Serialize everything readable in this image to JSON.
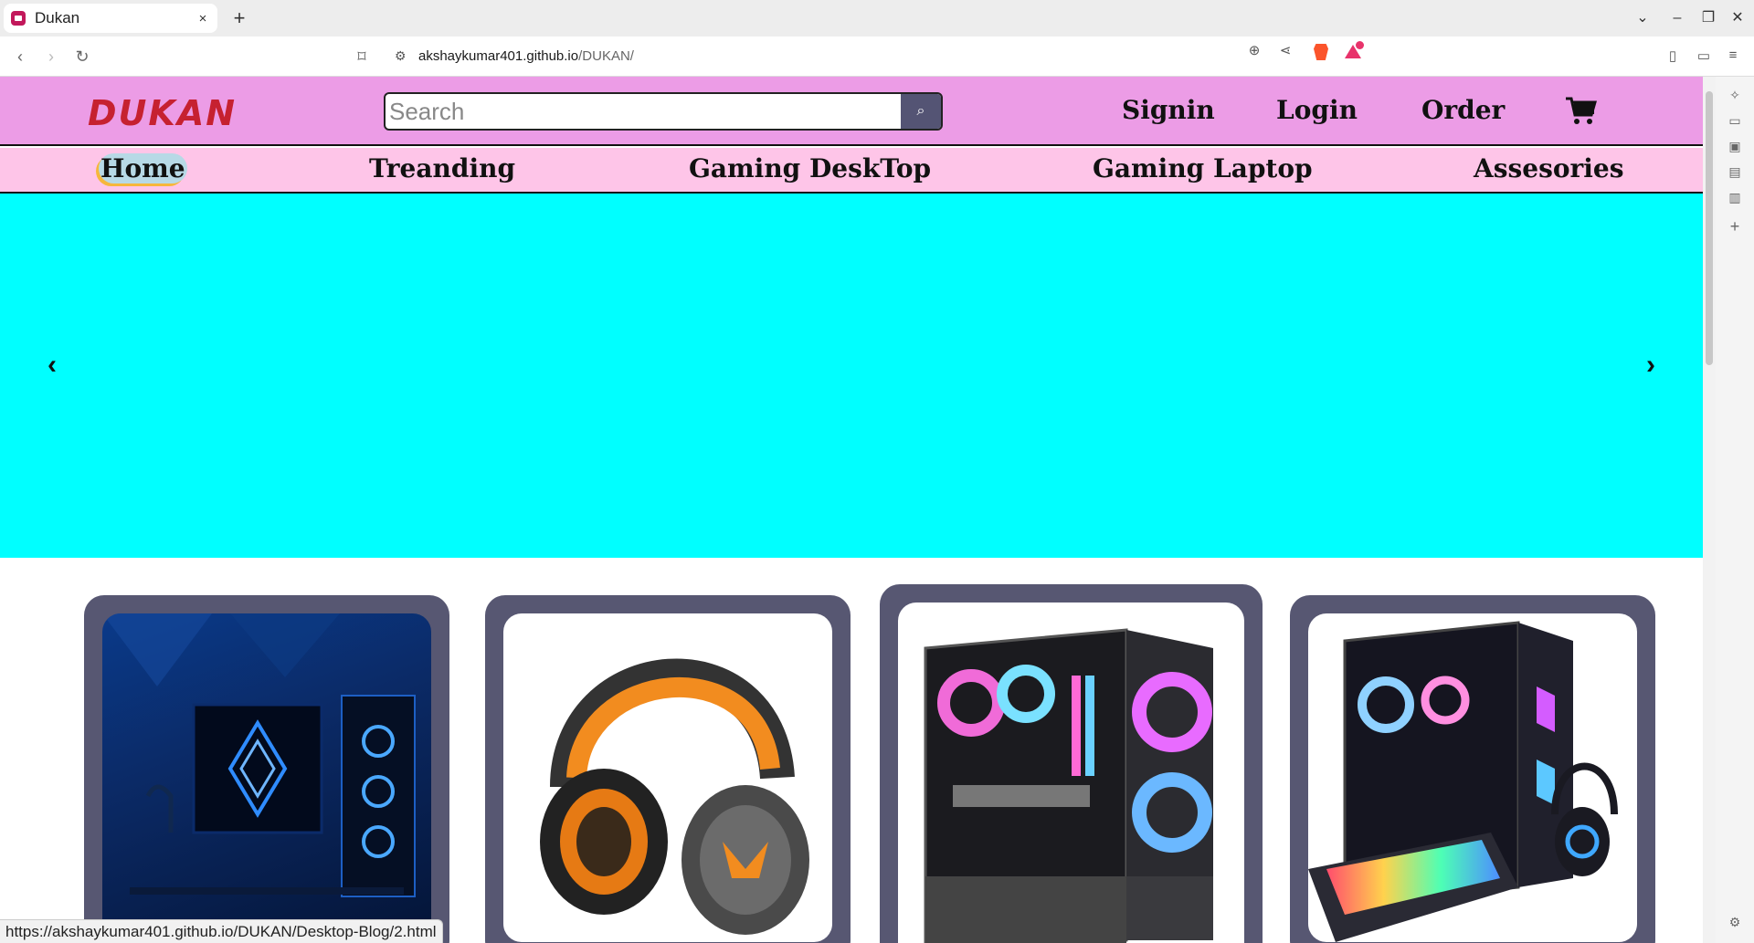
{
  "browser": {
    "tab_title": "Dukan",
    "tab_close": "×",
    "new_tab": "+",
    "url_host": "akshaykumar401.github.io",
    "url_path": "/DUKAN/",
    "status_url": "https://akshaykumar401.github.io/DUKAN/Desktop-Blog/2.html"
  },
  "header": {
    "logo": "DUKAN",
    "search_placeholder": "Search",
    "links": [
      "Signin",
      "Login",
      "Order"
    ]
  },
  "nav": {
    "items": [
      "Home",
      "Treanding",
      "Gaming DeskTop",
      "Gaming Laptop",
      "Assesories"
    ],
    "active": "Home"
  },
  "hero": {
    "background": "#00ffff",
    "prev": "‹",
    "next": "›"
  },
  "products": [
    {
      "image": "gaming-desk-setup-image"
    },
    {
      "image": "gaming-headset-image"
    },
    {
      "image": "pc-cabinet-image"
    },
    {
      "image": "gaming-pc-bundle-image"
    }
  ],
  "colors": {
    "header_bg": "#ec9ce6",
    "nav_bg": "#fec5e8",
    "card_bg": "#575772",
    "logo": "#c62130"
  }
}
